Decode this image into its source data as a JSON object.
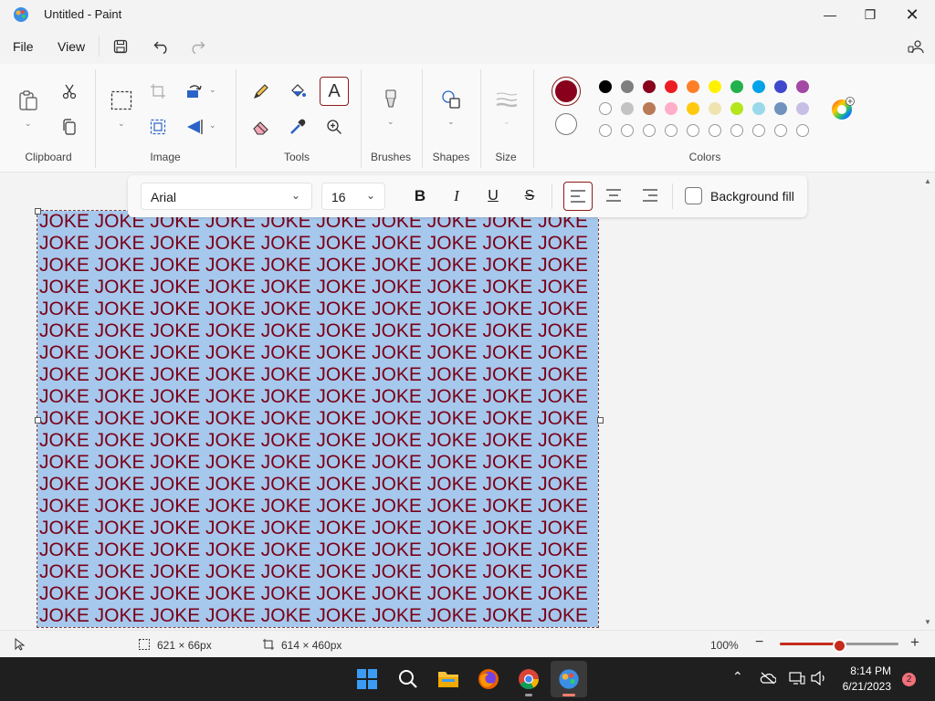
{
  "window": {
    "title": "Untitled - Paint"
  },
  "menu": {
    "file": "File",
    "view": "View"
  },
  "ribbon": {
    "groups": {
      "clipboard": "Clipboard",
      "image": "Image",
      "tools": "Tools",
      "brushes": "Brushes",
      "shapes": "Shapes",
      "size": "Size",
      "colors": "Colors"
    },
    "color1": "#88001b",
    "color2": "#ffffff",
    "palette_row1": [
      "#000000",
      "#7f7f7f",
      "#88001b",
      "#ed1c24",
      "#ff7f27",
      "#fff200",
      "#22b14c",
      "#00a2e8",
      "#3f48cc",
      "#a349a4"
    ],
    "palette_row2": [
      "#ffffff",
      "#c3c3c3",
      "#b97a57",
      "#ffaec9",
      "#ffc90e",
      "#efe4b0",
      "#b5e61d",
      "#99d9ea",
      "#7092be",
      "#c8bfe7"
    ],
    "palette_row3": [
      "#ffffff",
      "#ffffff",
      "#ffffff",
      "#ffffff",
      "#ffffff",
      "#ffffff",
      "#ffffff",
      "#ffffff",
      "#ffffff",
      "#ffffff"
    ]
  },
  "textbar": {
    "font": "Arial",
    "size": "16",
    "background_fill": "Background fill"
  },
  "canvas": {
    "lines": [
      "JOKE JOKE JOKE JOKE JOKE JOKE JOKE JOKE JOKE JOKE",
      "JOKE JOKE JOKE JOKE JOKE JOKE JOKE JOKE JOKE JOKE",
      "JOKE JOKE JOKE JOKE JOKE JOKE JOKE JOKE JOKE JOKE",
      "JOKE JOKE JOKE JOKE JOKE JOKE JOKE JOKE JOKE JOKE",
      "JOKE JOKE JOKE JOKE JOKE JOKE JOKE JOKE JOKE JOKE",
      "JOKE JOKE JOKE JOKE JOKE JOKE JOKE JOKE JOKE JOKE",
      "JOKE JOKE JOKE JOKE JOKE JOKE JOKE JOKE JOKE JOKE",
      "JOKE JOKE JOKE JOKE JOKE JOKE JOKE JOKE JOKE JOKE",
      "JOKE JOKE JOKE JOKE JOKE JOKE JOKE JOKE JOKE JOKE",
      "JOKE JOKE JOKE JOKE JOKE JOKE JOKE JOKE JOKE JOKE",
      "JOKE JOKE JOKE JOKE JOKE JOKE JOKE JOKE JOKE JOKE",
      "JOKE JOKE JOKE JOKE JOKE JOKE JOKE JOKE JOKE JOKE",
      "JOKE JOKE JOKE JOKE JOKE JOKE JOKE JOKE JOKE JOKE",
      "JOKE JOKE JOKE JOKE JOKE JOKE JOKE JOKE JOKE JOKE",
      "JOKE JOKE JOKE JOKE JOKE JOKE JOKE JOKE JOKE JOKE",
      "JOKE JOKE JOKE JOKE JOKE JOKE JOKE JOKE JOKE JOKE",
      "JOKE JOKE JOKE JOKE JOKE JOKE JOKE JOKE JOKE JOKE",
      "JOKE JOKE JOKE JOKE JOKE JOKE JOKE JOKE JOKE JOKE",
      "JOKE JOKE JOKE JOKE JOKE JOKE JOKE JOKE JOKE JOKE"
    ]
  },
  "status": {
    "selection": "621 × 66px",
    "canvas_size": "614 × 460px",
    "zoom": "100%",
    "zoom_level": 0.5
  },
  "taskbar": {
    "time": "8:14 PM",
    "date": "6/21/2023",
    "notifications": "2"
  }
}
